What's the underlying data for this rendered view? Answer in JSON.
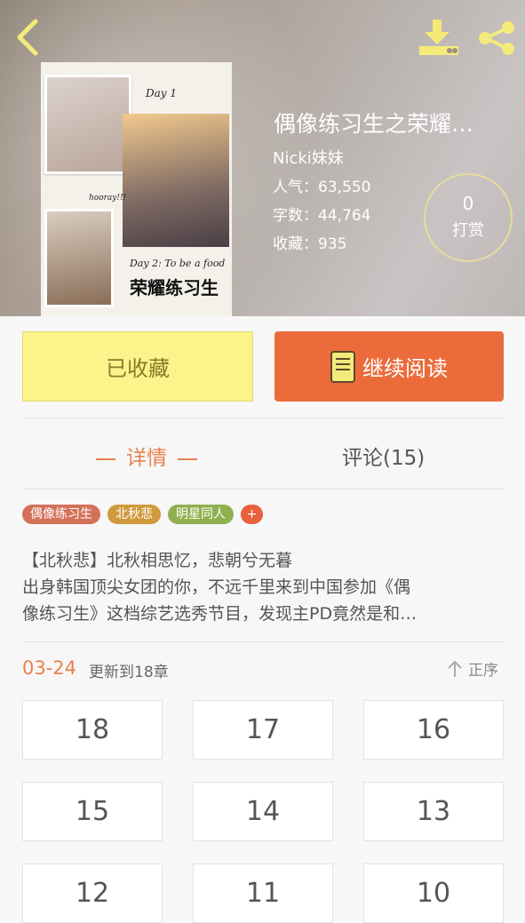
{
  "header": {
    "back_icon": "chevron-left-icon",
    "download_icon": "download-icon",
    "share_icon": "share-icon"
  },
  "cover": {
    "scribble_day1": "Day 1",
    "scribble_hooray": "hooray!!!",
    "scribble_day2": "Day 2: To be a food",
    "title": "荣耀练习生"
  },
  "book": {
    "title": "偶像练习生之荣耀…",
    "author": "Nicki妹妹",
    "popularity_label": "人气：",
    "popularity": "63,550",
    "words_label": "字数：",
    "words": "44,764",
    "favorites_label": "收藏：",
    "favorites": "935"
  },
  "tip": {
    "count": "0",
    "label": "打赏"
  },
  "actions": {
    "favorite_label": "已收藏",
    "read_label": "继续阅读"
  },
  "tabs": {
    "detail": "详情",
    "comments": "评论(15)"
  },
  "tags": [
    {
      "label": "偶像练习生",
      "color": "#d4715a"
    },
    {
      "label": "北秋悲",
      "color": "#cf9a3c"
    },
    {
      "label": "明星同人",
      "color": "#8fb04f"
    }
  ],
  "tag_more": "+",
  "description": {
    "line1": "【北秋悲】北秋相思忆，悲朝兮无暮",
    "line2": "出身韩国顶尖女团的你，不远千里来到中国参加《偶",
    "line3": "像练习生》这档综艺选秀节目，发现主PD竟然是和…"
  },
  "update": {
    "date": "03-24",
    "text": "更新到18章",
    "sort_label": "正序"
  },
  "chapters": [
    "18",
    "17",
    "16",
    "15",
    "14",
    "13",
    "12",
    "11",
    "10"
  ],
  "colors": {
    "accent_orange": "#ec6b3b",
    "favorite_yellow": "#fcf38a",
    "icon_yellow": "#f4ea7a"
  }
}
